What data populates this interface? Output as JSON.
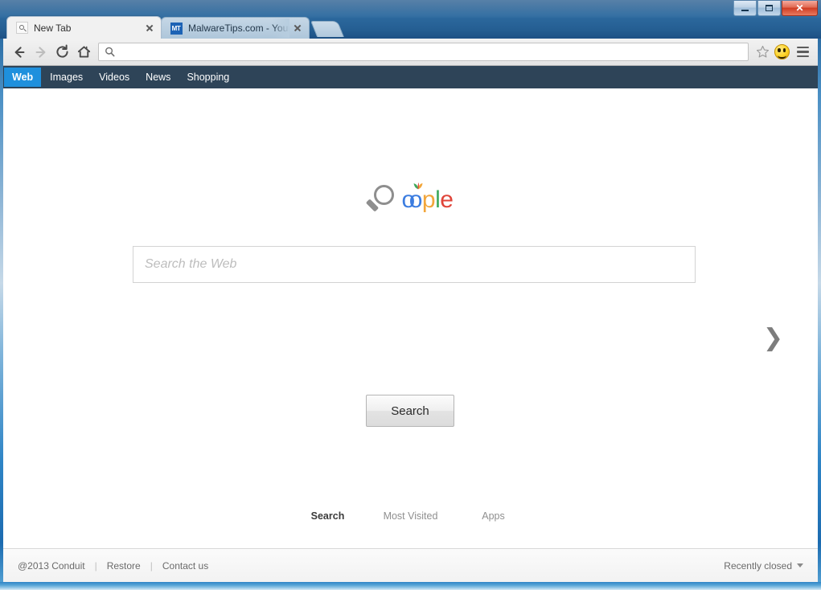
{
  "window": {
    "controls": {
      "minimize": "minimize-button",
      "maximize": "maximize-button",
      "close_label": "✕"
    }
  },
  "tabs": [
    {
      "title": "New Tab",
      "favicon": "search-icon",
      "active": true,
      "close_label": "close-tab"
    },
    {
      "title": "MalwareTips.com - Your F",
      "favicon": "mt-favicon",
      "favicon_text": "MT",
      "active": false,
      "close_label": "close-tab"
    }
  ],
  "newtab_button": {
    "label": ""
  },
  "toolbar": {
    "back": "back-arrow",
    "forward": "forward-arrow",
    "reload": "reload-arrow",
    "home": "home-icon",
    "omnibox": {
      "value": "",
      "placeholder": ""
    },
    "star": "star-icon",
    "extension": "smiley-icon",
    "menu": "hamburger-icon"
  },
  "conduit_nav": {
    "items": [
      {
        "label": "Web",
        "active": true
      },
      {
        "label": "Images",
        "active": false
      },
      {
        "label": "Videos",
        "active": false
      },
      {
        "label": "News",
        "active": false
      },
      {
        "label": "Shopping",
        "active": false
      }
    ],
    "bg_color": "#2e4458",
    "active_color": "#1f90dd"
  },
  "logo": {
    "wordmark": [
      {
        "ch": "o",
        "color": "#3c7de0"
      },
      {
        "ch": "o",
        "color": "#3c7de0"
      },
      {
        "ch": "p",
        "color": "#f2a63b"
      },
      {
        "ch": "l",
        "color": "#3fa95c"
      },
      {
        "ch": "e",
        "color": "#e0453a"
      }
    ],
    "magnifier_color": "#8e8e8e",
    "leaf_colors": [
      "#3fa95c",
      "#f2a63b",
      "#e0453a"
    ]
  },
  "search": {
    "input_value": "",
    "placeholder": "Search the Web",
    "button_label": "Search"
  },
  "side_chevron": {
    "glyph": "❯"
  },
  "bottom_tabs": [
    {
      "label": "Search",
      "active": true
    },
    {
      "label": "Most Visited",
      "active": false
    },
    {
      "label": "Apps",
      "active": false
    }
  ],
  "footer": {
    "copyright": "@2013 Conduit",
    "sep1": "|",
    "restore": "Restore",
    "sep2": "|",
    "contact": "Contact us",
    "recently_closed": "Recently closed"
  }
}
